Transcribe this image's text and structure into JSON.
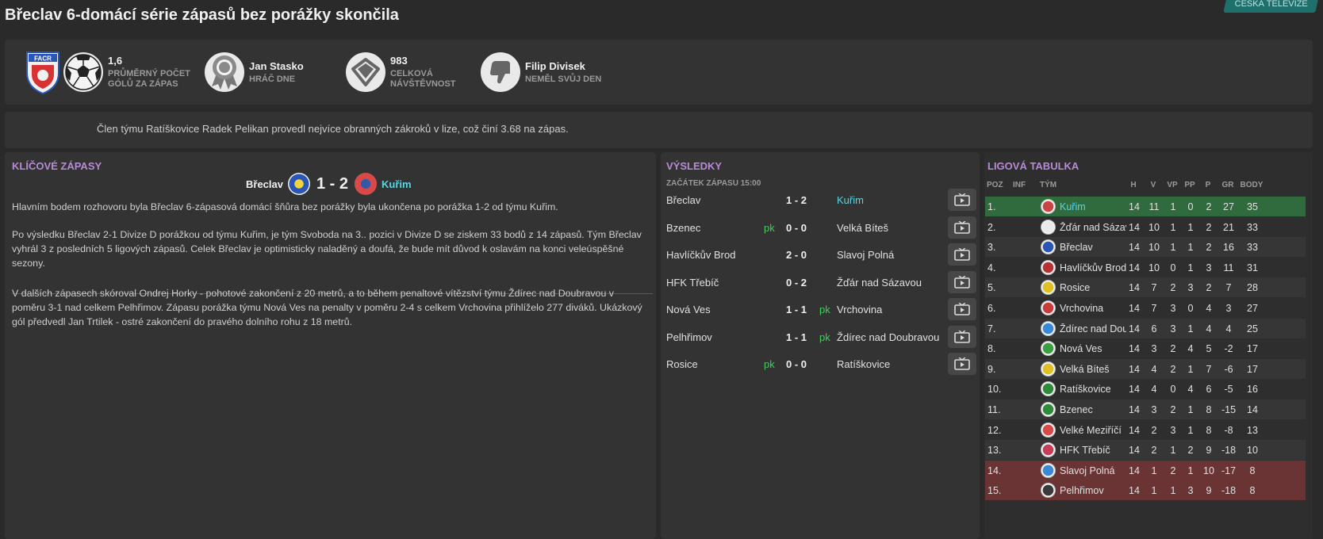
{
  "headline": "Břeclav 6-domácí série zápasů bez porážky skončila",
  "tv_badge": "ČESKÁ TELEVIZE",
  "stats": [
    {
      "icon": "soccer-ball-icon",
      "value": "1,6",
      "label1": "PRŮMĚRNÝ POČET",
      "label2": "GÓLŮ ZA ZÁPAS"
    },
    {
      "icon": "award-medal-icon",
      "value": "Jan Stasko",
      "label1": "HRÁČ DNE",
      "label2": ""
    },
    {
      "icon": "stadium-icon",
      "value": "983",
      "label1": "CELKOVÁ",
      "label2": "NÁVŠTĚVNOST"
    },
    {
      "icon": "thumbs-down-icon",
      "value": "Filip Divisek",
      "label1": "NEMĚL SVŮJ DEN",
      "label2": ""
    }
  ],
  "fact": "Člen týmu Ratíškovice Radek Pelikan provedl nejvíce obranných zákroků v lize, což činí 3.68 na zápas.",
  "key_matches": {
    "title": "KLÍČOVÉ ZÁPASY",
    "home": "Břeclav",
    "score": "1 - 2",
    "away": "Kuřim",
    "para1": "Hlavním bodem rozhovoru byla Břeclav 6-zápasová domácí šňůra bez porážky byla ukončena po porážka 1-2 od týmu Kuřim.",
    "para2": "Po výsledku Břeclav 2-1 Divize D porážkou od týmu Kuřim, je tým Svoboda na 3.. pozici v Divize D se ziskem 33 bodů z 14 zápasů. Tým Břeclav vyhrál 3 z posledních 5 ligových zápasů. Celek Břeclav je optimisticky naladěný a doufá, že bude mít důvod k oslavám na konci veleúspěšné sezony.",
    "para3": "V dalších zápasech skóroval Ondrej Horky - pohotové zakončení z 20 metrů, a to během penaltové vítězství týmu Ždírec nad Doubravou v poměru 3-1 nad celkem Pelhřimov. Zápasu porážka týmu Nová Ves na penalty v poměru 2-4 s celkem Vrchovina přihlíželo 277 diváků. Ukázkový gól předvedl Jan Trtilek - ostré zakončení do pravého dolního rohu z 18 metrů."
  },
  "results": {
    "title": "VÝSLEDKY",
    "kickoff": "ZAČÁTEK ZÁPASU 15:00",
    "rows": [
      {
        "home": "Břeclav",
        "pk_home": "",
        "score": "1 - 2",
        "pk_away": "",
        "away": "Kuřim"
      },
      {
        "home": "Bzenec",
        "pk_home": "pk",
        "score": "0 - 0",
        "pk_away": "",
        "away": "Velká Bíteš"
      },
      {
        "home": "Havlíčkův Brod",
        "pk_home": "",
        "score": "2 - 0",
        "pk_away": "",
        "away": "Slavoj Polná"
      },
      {
        "home": "HFK Třebíč",
        "pk_home": "",
        "score": "0 - 2",
        "pk_away": "",
        "away": "Žďár nad Sázavou"
      },
      {
        "home": "Nová Ves",
        "pk_home": "",
        "score": "1 - 1",
        "pk_away": "pk",
        "away": "Vrchovina"
      },
      {
        "home": "Pelhřimov",
        "pk_home": "",
        "score": "1 - 1",
        "pk_away": "pk",
        "away": "Ždírec nad Doubravou"
      },
      {
        "home": "Rosice",
        "pk_home": "pk",
        "score": "0 - 0",
        "pk_away": "",
        "away": "Ratíškovice"
      }
    ]
  },
  "league": {
    "title": "LIGOVÁ TABULKA",
    "headers": {
      "pos": "POZ",
      "inf": "INF",
      "team": "TÝM",
      "h": "H",
      "v": "V",
      "vp": "VP",
      "pp": "PP",
      "p": "P",
      "gr": "GR",
      "b": "BODY"
    },
    "rows": [
      {
        "pos": "1.",
        "team": "Kuřim",
        "h": "14",
        "v": "11",
        "vp": "1",
        "pp": "0",
        "p": "2",
        "gr": "27",
        "b": "35",
        "zone": "promo",
        "crest": "#c84545"
      },
      {
        "pos": "2.",
        "team": "Žďár nad Sázavou",
        "h": "14",
        "v": "10",
        "vp": "1",
        "pp": "1",
        "p": "2",
        "gr": "21",
        "b": "33",
        "zone": "",
        "crest": "#eaeaea"
      },
      {
        "pos": "3.",
        "team": "Břeclav",
        "h": "14",
        "v": "10",
        "vp": "1",
        "pp": "1",
        "p": "2",
        "gr": "16",
        "b": "33",
        "zone": "alt",
        "crest": "#2a56b8"
      },
      {
        "pos": "4.",
        "team": "Havlíčkův Brod",
        "h": "14",
        "v": "10",
        "vp": "0",
        "pp": "1",
        "p": "3",
        "gr": "11",
        "b": "31",
        "zone": "",
        "crest": "#b83232"
      },
      {
        "pos": "5.",
        "team": "Rosice",
        "h": "14",
        "v": "7",
        "vp": "2",
        "pp": "3",
        "p": "2",
        "gr": "7",
        "b": "28",
        "zone": "alt",
        "crest": "#e0c020"
      },
      {
        "pos": "6.",
        "team": "Vrchovina",
        "h": "14",
        "v": "7",
        "vp": "3",
        "pp": "0",
        "p": "4",
        "gr": "3",
        "b": "27",
        "zone": "",
        "crest": "#c83c3c"
      },
      {
        "pos": "7.",
        "team": "Ždírec nad Doubravou",
        "h": "14",
        "v": "6",
        "vp": "3",
        "pp": "1",
        "p": "4",
        "gr": "4",
        "b": "25",
        "zone": "alt",
        "crest": "#3a88d8"
      },
      {
        "pos": "8.",
        "team": "Nová Ves",
        "h": "14",
        "v": "3",
        "vp": "2",
        "pp": "4",
        "p": "5",
        "gr": "-2",
        "b": "17",
        "zone": "",
        "crest": "#3aa040"
      },
      {
        "pos": "9.",
        "team": "Velká Bíteš",
        "h": "14",
        "v": "4",
        "vp": "2",
        "pp": "1",
        "p": "7",
        "gr": "-6",
        "b": "17",
        "zone": "alt",
        "crest": "#e0c020"
      },
      {
        "pos": "10.",
        "team": "Ratíškovice",
        "h": "14",
        "v": "4",
        "vp": "0",
        "pp": "4",
        "p": "6",
        "gr": "-5",
        "b": "16",
        "zone": "",
        "crest": "#2f8a3a"
      },
      {
        "pos": "11.",
        "team": "Bzenec",
        "h": "14",
        "v": "3",
        "vp": "2",
        "pp": "1",
        "p": "8",
        "gr": "-15",
        "b": "14",
        "zone": "alt",
        "crest": "#2f8a3a"
      },
      {
        "pos": "12.",
        "team": "Velké Meziříčí",
        "h": "14",
        "v": "2",
        "vp": "3",
        "pp": "1",
        "p": "8",
        "gr": "-8",
        "b": "13",
        "zone": "",
        "crest": "#d84a4a"
      },
      {
        "pos": "13.",
        "team": "HFK Třebíč",
        "h": "14",
        "v": "2",
        "vp": "1",
        "pp": "2",
        "p": "9",
        "gr": "-18",
        "b": "10",
        "zone": "alt",
        "crest": "#c83c5a"
      },
      {
        "pos": "14.",
        "team": "Slavoj Polná",
        "h": "14",
        "v": "1",
        "vp": "2",
        "pp": "1",
        "p": "10",
        "gr": "-17",
        "b": "8",
        "zone": "releg",
        "crest": "#3a88d8"
      },
      {
        "pos": "15.",
        "team": "Pelhřimov",
        "h": "14",
        "v": "1",
        "vp": "1",
        "pp": "3",
        "p": "9",
        "gr": "-18",
        "b": "8",
        "zone": "releg",
        "crest": "#3a3a3a"
      }
    ]
  },
  "colors": {
    "accent_title": "#b98ad9",
    "highlight_team": "#5fd3e0",
    "promo_row": "#2f6b3d",
    "releg_row": "#6a3434",
    "pk": "#3ad05a"
  }
}
